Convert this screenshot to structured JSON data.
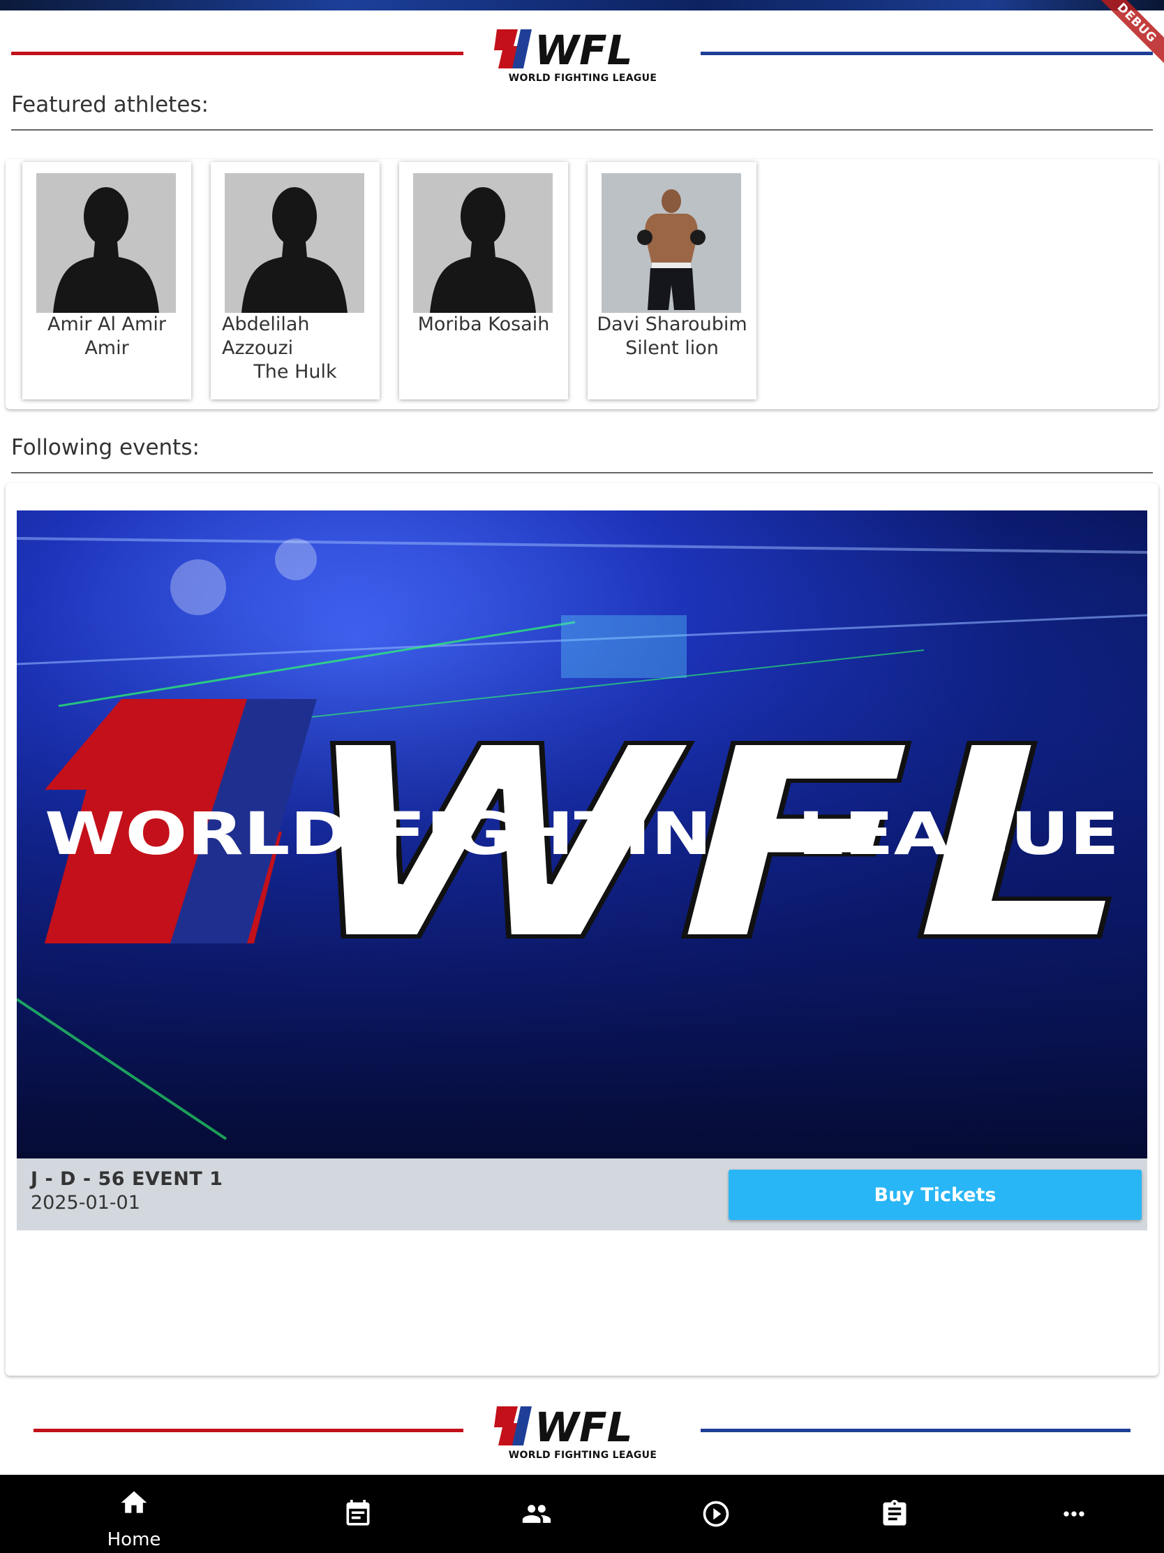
{
  "app": {
    "debug_banner": "DEBUG",
    "brand_subtitle": "WORLD FIGHTING LEAGUE",
    "brand_mark": "WFL",
    "colors": {
      "brand_red": "#c4101a",
      "brand_blue": "#1f3f97",
      "button": "#29b6f6",
      "nav_bg": "#000000"
    }
  },
  "athletes_section": {
    "title": "Featured athletes:",
    "items": [
      {
        "name": "Amir Al Amir",
        "nickname": "Amir",
        "photo": "silhouette-placeholder"
      },
      {
        "name": "Abdelilah Azzouzi",
        "nickname": "The Hulk",
        "photo": "silhouette-placeholder"
      },
      {
        "name": "Moriba Kosaih",
        "nickname": "",
        "photo": "silhouette-placeholder"
      },
      {
        "name": "Davi Sharoubim",
        "nickname": "Silent lion",
        "photo": "fighter-photo"
      }
    ]
  },
  "events_section": {
    "title": "Following events:",
    "events": [
      {
        "name": "J - D - 56 EVENT 1",
        "date": "2025-01-01",
        "button_label": "Buy Tickets",
        "banner_text": "WORLD FIGHTING LEAGUE",
        "banner_logo": "WFL"
      }
    ]
  },
  "nav": {
    "items": [
      {
        "label": "Home",
        "icon": "home-icon",
        "active": true
      },
      {
        "label": "",
        "icon": "calendar-icon"
      },
      {
        "label": "",
        "icon": "people-icon"
      },
      {
        "label": "",
        "icon": "play-circle-icon"
      },
      {
        "label": "",
        "icon": "clipboard-icon"
      },
      {
        "label": "",
        "icon": "more-horizontal-icon"
      }
    ]
  }
}
